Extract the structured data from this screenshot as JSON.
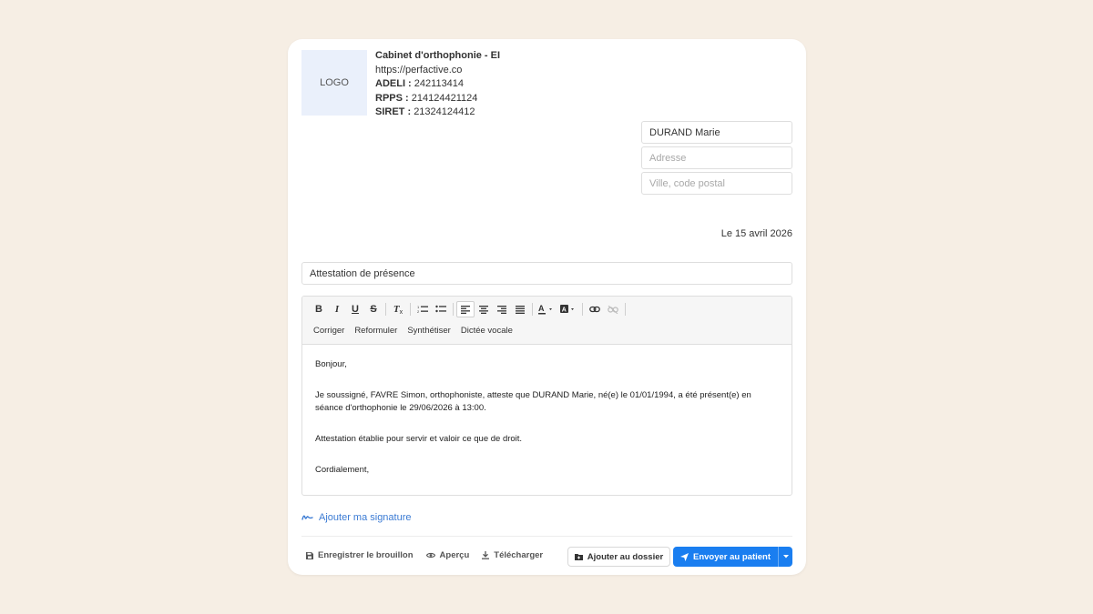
{
  "header": {
    "logo_text": "LOGO",
    "practice_name": "Cabinet d'orthophonie - EI",
    "website": "https://perfactive.co",
    "adeli_label": "ADELI :",
    "adeli_value": "242113414",
    "rpps_label": "RPPS :",
    "rpps_value": "214124421124",
    "siret_label": "SIRET :",
    "siret_value": "21324124412"
  },
  "recipient": {
    "name_value": "DURAND Marie",
    "address_placeholder": "Adresse",
    "city_placeholder": "Ville, code postal"
  },
  "letter": {
    "date": "Le 15 avril 2026",
    "subject": "Attestation de présence",
    "paragraphs": [
      "Bonjour,",
      "Je soussigné, FAVRE Simon, orthophoniste, atteste que DURAND Marie, né(e) le 01/01/1994, a été présent(e) en séance d'orthophonie le 29/06/2026 à 13:00.",
      "Attestation établie pour servir et valoir ce que de droit.",
      "Cordialement,"
    ]
  },
  "toolbar": {
    "bold": "B",
    "italic": "I",
    "underline": "U",
    "strike": "S",
    "clear_format": "T",
    "ai_actions": [
      "Corriger",
      "Reformuler",
      "Synthétiser",
      "Dictée vocale"
    ]
  },
  "signature": {
    "label": "Ajouter ma signature"
  },
  "footer": {
    "save_draft": "Enregistrer le brouillon",
    "preview": "Aperçu",
    "download": "Télécharger",
    "add_to_file": "Ajouter au dossier",
    "send_to_patient": "Envoyer au patient"
  },
  "colors": {
    "background": "#f6eee4",
    "accent": "#1a7ef0",
    "link": "#3b7bd4",
    "logo_bg": "#eaf0fb"
  }
}
